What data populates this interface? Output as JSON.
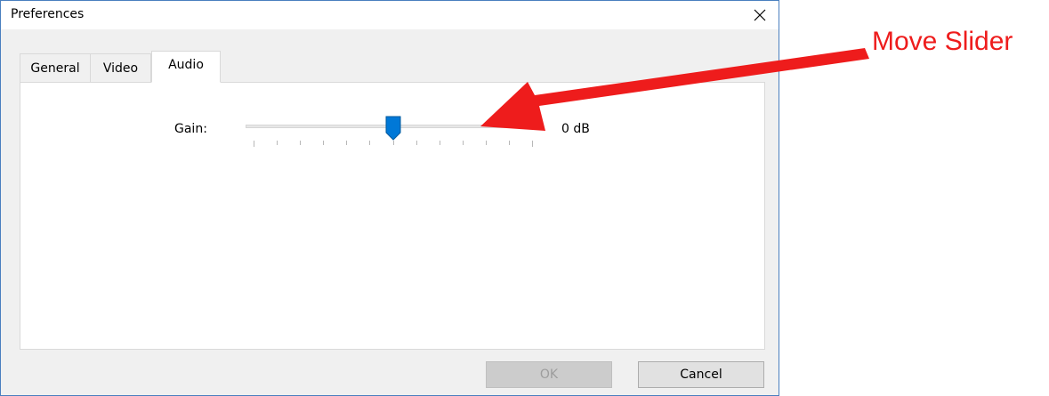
{
  "window": {
    "title": "Preferences",
    "close_icon": "close-icon"
  },
  "tabs": [
    {
      "label": "General",
      "active": false
    },
    {
      "label": "Video",
      "active": false
    },
    {
      "label": "Audio",
      "active": true
    }
  ],
  "audio": {
    "gain_label": "Gain:",
    "gain_value_text": "0 dB",
    "slider_position_fraction": 0.5,
    "tick_count": 13
  },
  "buttons": {
    "ok_label": "OK",
    "ok_enabled": false,
    "cancel_label": "Cancel"
  },
  "annotation": {
    "text": "Move Slider",
    "color": "#ee1c1c"
  },
  "colors": {
    "window_border": "#4a7fbf",
    "thumb": "#0078d7"
  }
}
